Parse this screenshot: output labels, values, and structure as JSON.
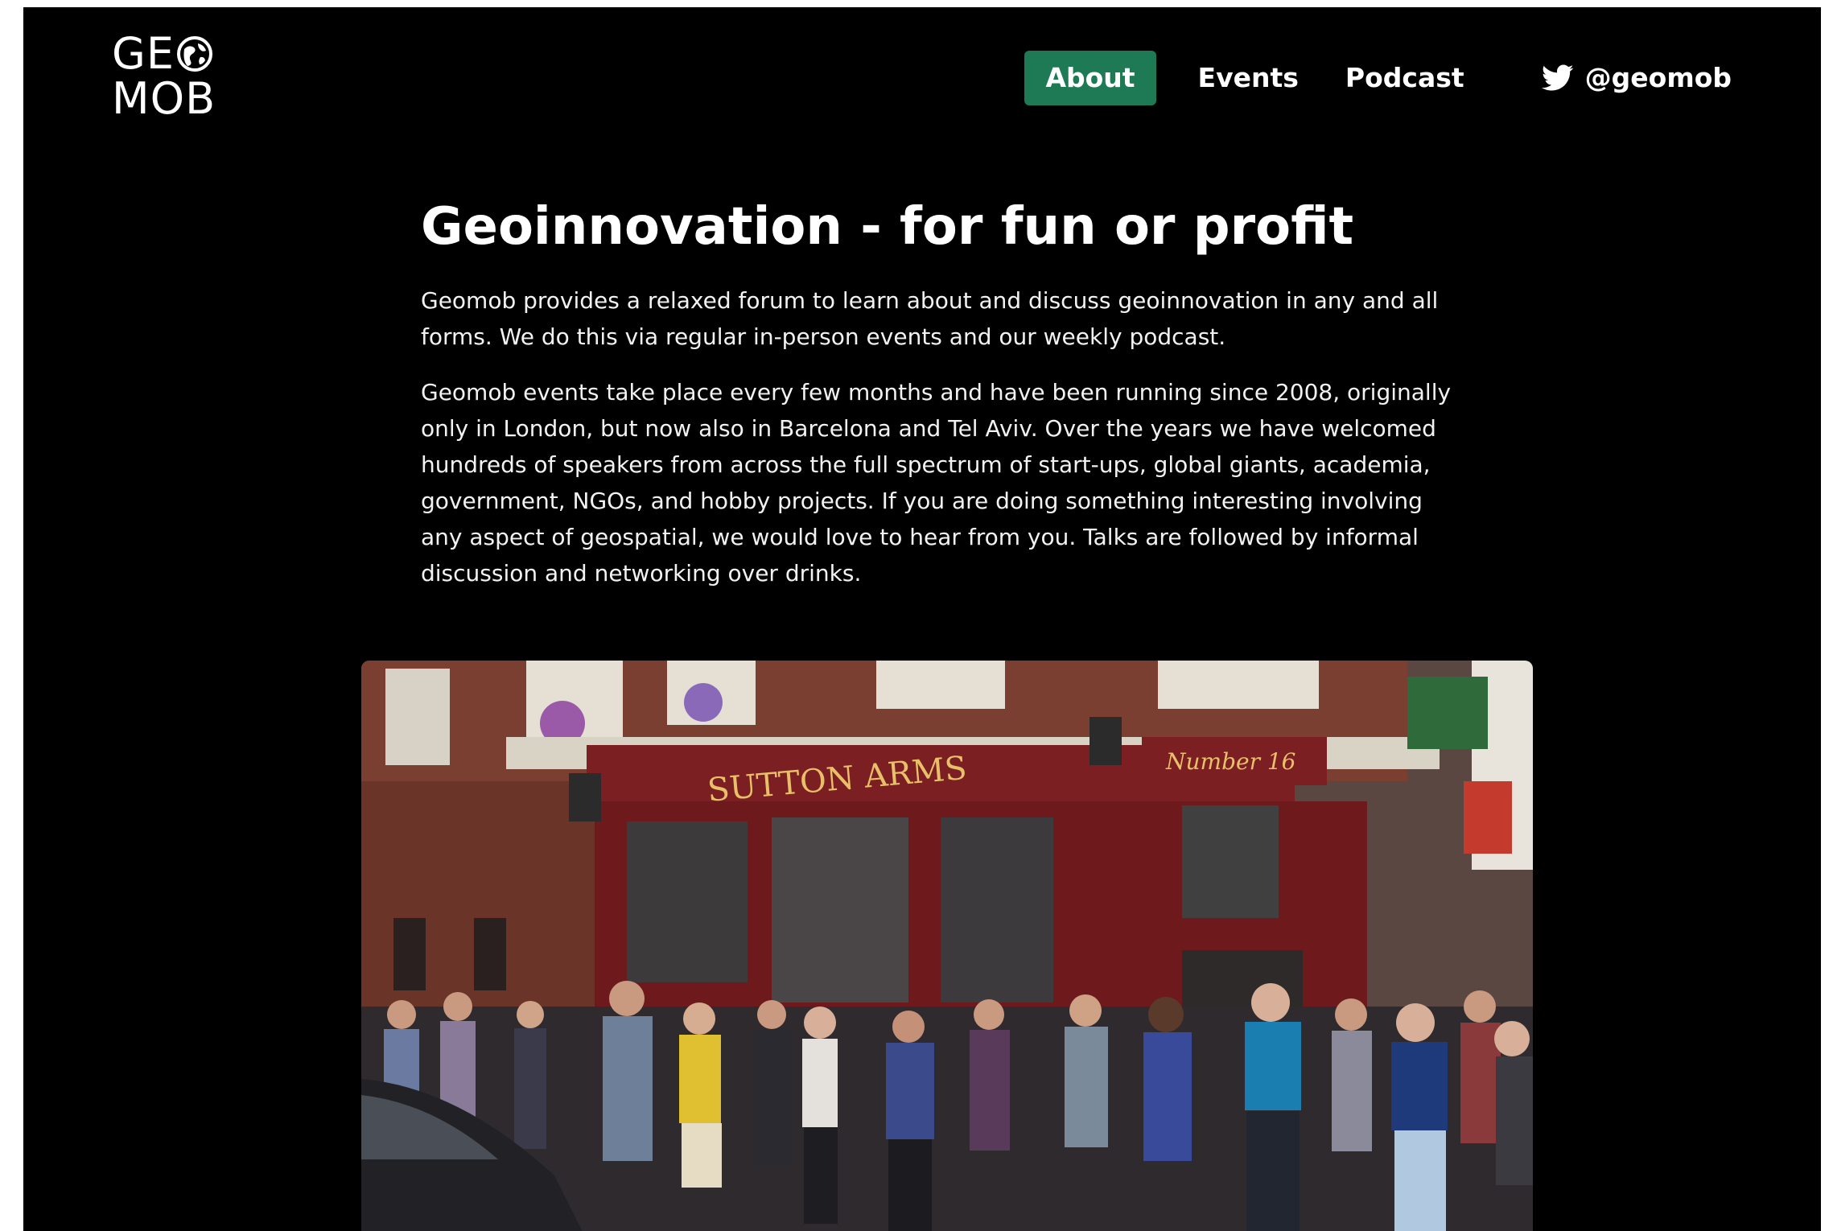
{
  "logo": {
    "line1": "GE",
    "line2": "MOB"
  },
  "nav": {
    "items": [
      {
        "label": "About",
        "active": true
      },
      {
        "label": "Events",
        "active": false
      },
      {
        "label": "Podcast",
        "active": false
      }
    ],
    "twitter": {
      "icon": "twitter-icon",
      "handle": "@geomob"
    }
  },
  "main": {
    "title": "Geoinnovation - for fun or profit",
    "paragraphs": [
      "Geomob provides a relaxed forum to learn about and discuss geoinnovation in any and all forms. We do this via regular in-person events and our weekly podcast.",
      "Geomob events take place every few months and have been running since 2008, originally only in London, but now also in Barcelona and Tel Aviv. Over the years we have welcomed hundreds of speakers from across the full spectrum of start-ups, global giants, academia, government, NGOs, and hobby projects. If you are doing something interesting involving any aspect of geospatial, we would love to hear from you. Talks are followed by informal discussion and networking over drinks."
    ]
  },
  "photo": {
    "pub_sign": "SUTTON ARMS",
    "pub_number": "Number 16"
  },
  "colors": {
    "background": "#000000",
    "accent": "#1e7a55",
    "text": "#ffffff"
  }
}
